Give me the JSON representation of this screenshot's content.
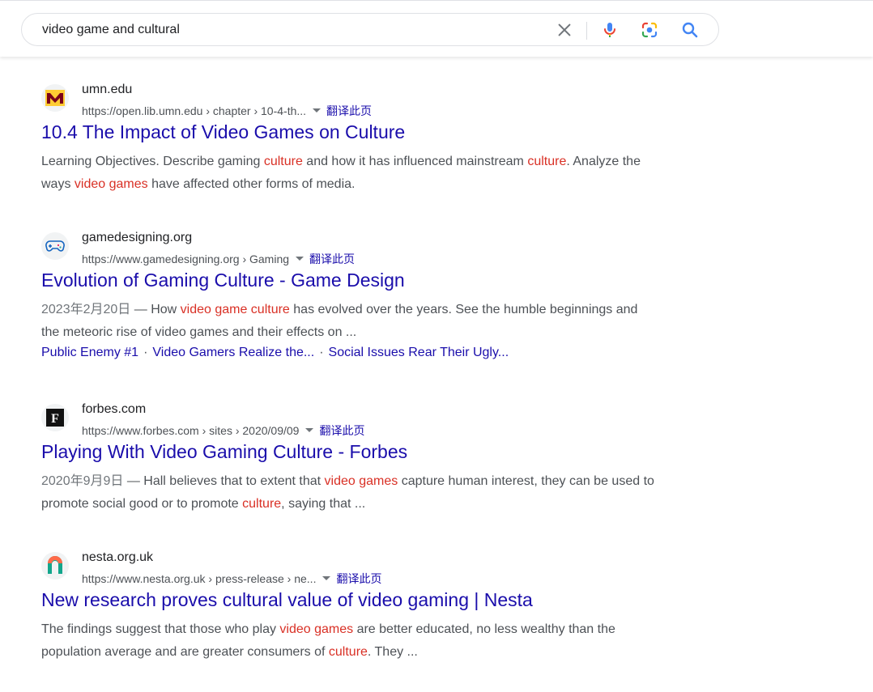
{
  "search": {
    "query": "video game and cultural",
    "clear_icon": "close-icon",
    "mic_icon": "mic-icon",
    "lens_icon": "camera-lens-icon",
    "search_icon": "search-icon"
  },
  "results": [
    {
      "site_name": "umn.edu",
      "url": "https://open.lib.umn.edu › chapter › 10-4-th...",
      "translate": "翻译此页",
      "title": "10.4 The Impact of Video Games on Culture",
      "snippet_parts": [
        [
          "Learning Objectives. Describe gaming ",
          false
        ],
        [
          "culture",
          true
        ],
        [
          " and how it has influenced mainstream ",
          false
        ],
        [
          "culture",
          true
        ],
        [
          ". Analyze the ways ",
          false
        ],
        [
          "video games",
          true
        ],
        [
          " have affected other forms of media.",
          false
        ]
      ]
    },
    {
      "site_name": "gamedesigning.org",
      "url": "https://www.gamedesigning.org › Gaming",
      "translate": "翻译此页",
      "title": "Evolution of Gaming Culture - Game Design",
      "date": "2023年2月20日",
      "snippet_parts": [
        [
          " — How ",
          false
        ],
        [
          "video game culture",
          true
        ],
        [
          " has evolved over the years. See the humble beginnings and the meteoric rise of video games and their effects on ...",
          false
        ]
      ],
      "sitelinks": [
        "Public Enemy #1",
        "Video Gamers Realize the...",
        "Social Issues Rear Their Ugly..."
      ]
    },
    {
      "site_name": "forbes.com",
      "url": "https://www.forbes.com › sites › 2020/09/09",
      "translate": "翻译此页",
      "title": "Playing With Video Gaming Culture - Forbes",
      "date": "2020年9月9日",
      "snippet_parts": [
        [
          " — Hall believes that to extent that ",
          false
        ],
        [
          "video games",
          true
        ],
        [
          " capture human interest, they can be used to promote social good or to promote ",
          false
        ],
        [
          "culture",
          true
        ],
        [
          ", saying that ...",
          false
        ]
      ]
    },
    {
      "site_name": "nesta.org.uk",
      "url": "https://www.nesta.org.uk › press-release › ne...",
      "translate": "翻译此页",
      "title": "New research proves cultural value of video gaming | Nesta",
      "snippet_parts": [
        [
          "The findings suggest that those who play ",
          false
        ],
        [
          "video games",
          true
        ],
        [
          " are better educated, no less wealthy than the population average and are greater consumers of ",
          false
        ],
        [
          "culture",
          true
        ],
        [
          ". They ...",
          false
        ]
      ]
    }
  ],
  "colors": {
    "link": "#1a0dab",
    "highlight": "#d93025",
    "snippet_text": "#4d5156"
  }
}
